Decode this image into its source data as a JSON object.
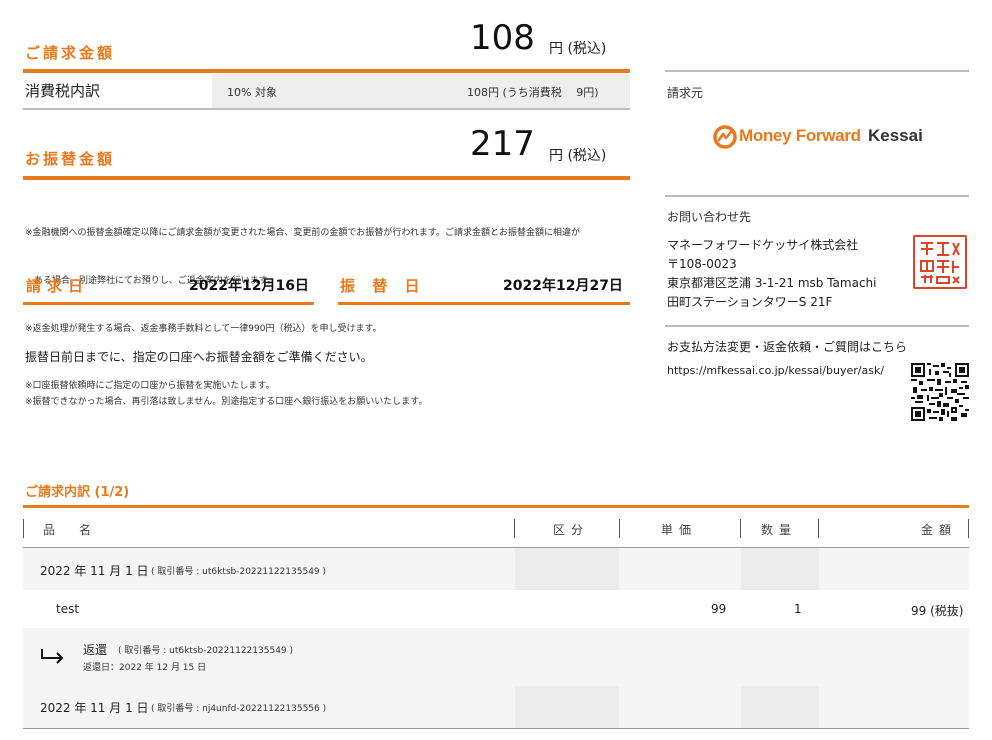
{
  "billing": {
    "title": "ご請求金額",
    "amount": "108",
    "unit": "円 (税込)"
  },
  "tax": {
    "label": "消費税内訳",
    "rate": "10% 対象",
    "detail": "108円 (うち消費税　 9円)"
  },
  "transfer": {
    "title": "お振替金額",
    "amount": "217",
    "unit": "円 (税込)"
  },
  "notes_top": [
    "※金融機関への振替金額確定以降にご請求金額が変更された場合、変更前の金額でお振替が行われます。ご請求金額とお振替金額に相違が",
    "　ある場合、別途弊社にてお預りし、ご返金案内を行います。",
    "※返金処理が発生する場合、返金事務手数料として一律990円（税込）を申し受けます。"
  ],
  "dates": {
    "invoice_label": "請求日",
    "invoice_date": "2022年12月16日",
    "transfer_label": "振 替 日",
    "transfer_date": "2022年12月27日"
  },
  "prepare_message": "振替日前日までに、指定の口座へお振替金額をご準備ください。",
  "notes_bottom": [
    "※口座振替依頼時にご指定の口座から振替を実施いたします。",
    "※振替できなかった場合、再引落は致しません。別途指定する口座へ銀行振込をお願いいたします。"
  ],
  "issuer": {
    "label": "請求元",
    "logo_text": "Money Forward",
    "logo_suffix": "Kessai",
    "stamp_text": "マネーフォワードケッサイ株式会社印"
  },
  "contact": {
    "label": "お問い合わせ先",
    "company": "マネーフォワードケッサイ株式会社",
    "postal": "〒108-0023",
    "address1": "東京都港区芝浦 3-1-21 msb Tamachi",
    "address2": "田町ステーションタワーS 21F"
  },
  "support": {
    "label": "お支払方法変更・返金依頼・ご質問はこちら",
    "url": "https://mfkessai.co.jp/kessai/buyer/ask/"
  },
  "details": {
    "title": "ご請求内訳 (1/2)",
    "headers": [
      "品　名",
      "区分",
      "単価",
      "数量",
      "金額"
    ],
    "rows": [
      {
        "date": "2022 年 11 月 1 日",
        "txn": "( 取引番号 : ut6ktsb-20221122135549 )"
      },
      {
        "item": "test",
        "unit_price": "99",
        "qty": "1",
        "amount": "99 (税抜)"
      },
      {
        "refund_label": "返還",
        "refund_txn": "( 取引番号 : ut6ktsb-20221122135549 )",
        "refund_date": "返還日：2022 年 12 月 15 日"
      },
      {
        "date": "2022 年 11 月 1 日",
        "txn": "( 取引番号 : nj4unfd-20221122135556 )"
      }
    ]
  },
  "colors": {
    "accent": "#e87a1e",
    "stamp": "#d9442a"
  }
}
